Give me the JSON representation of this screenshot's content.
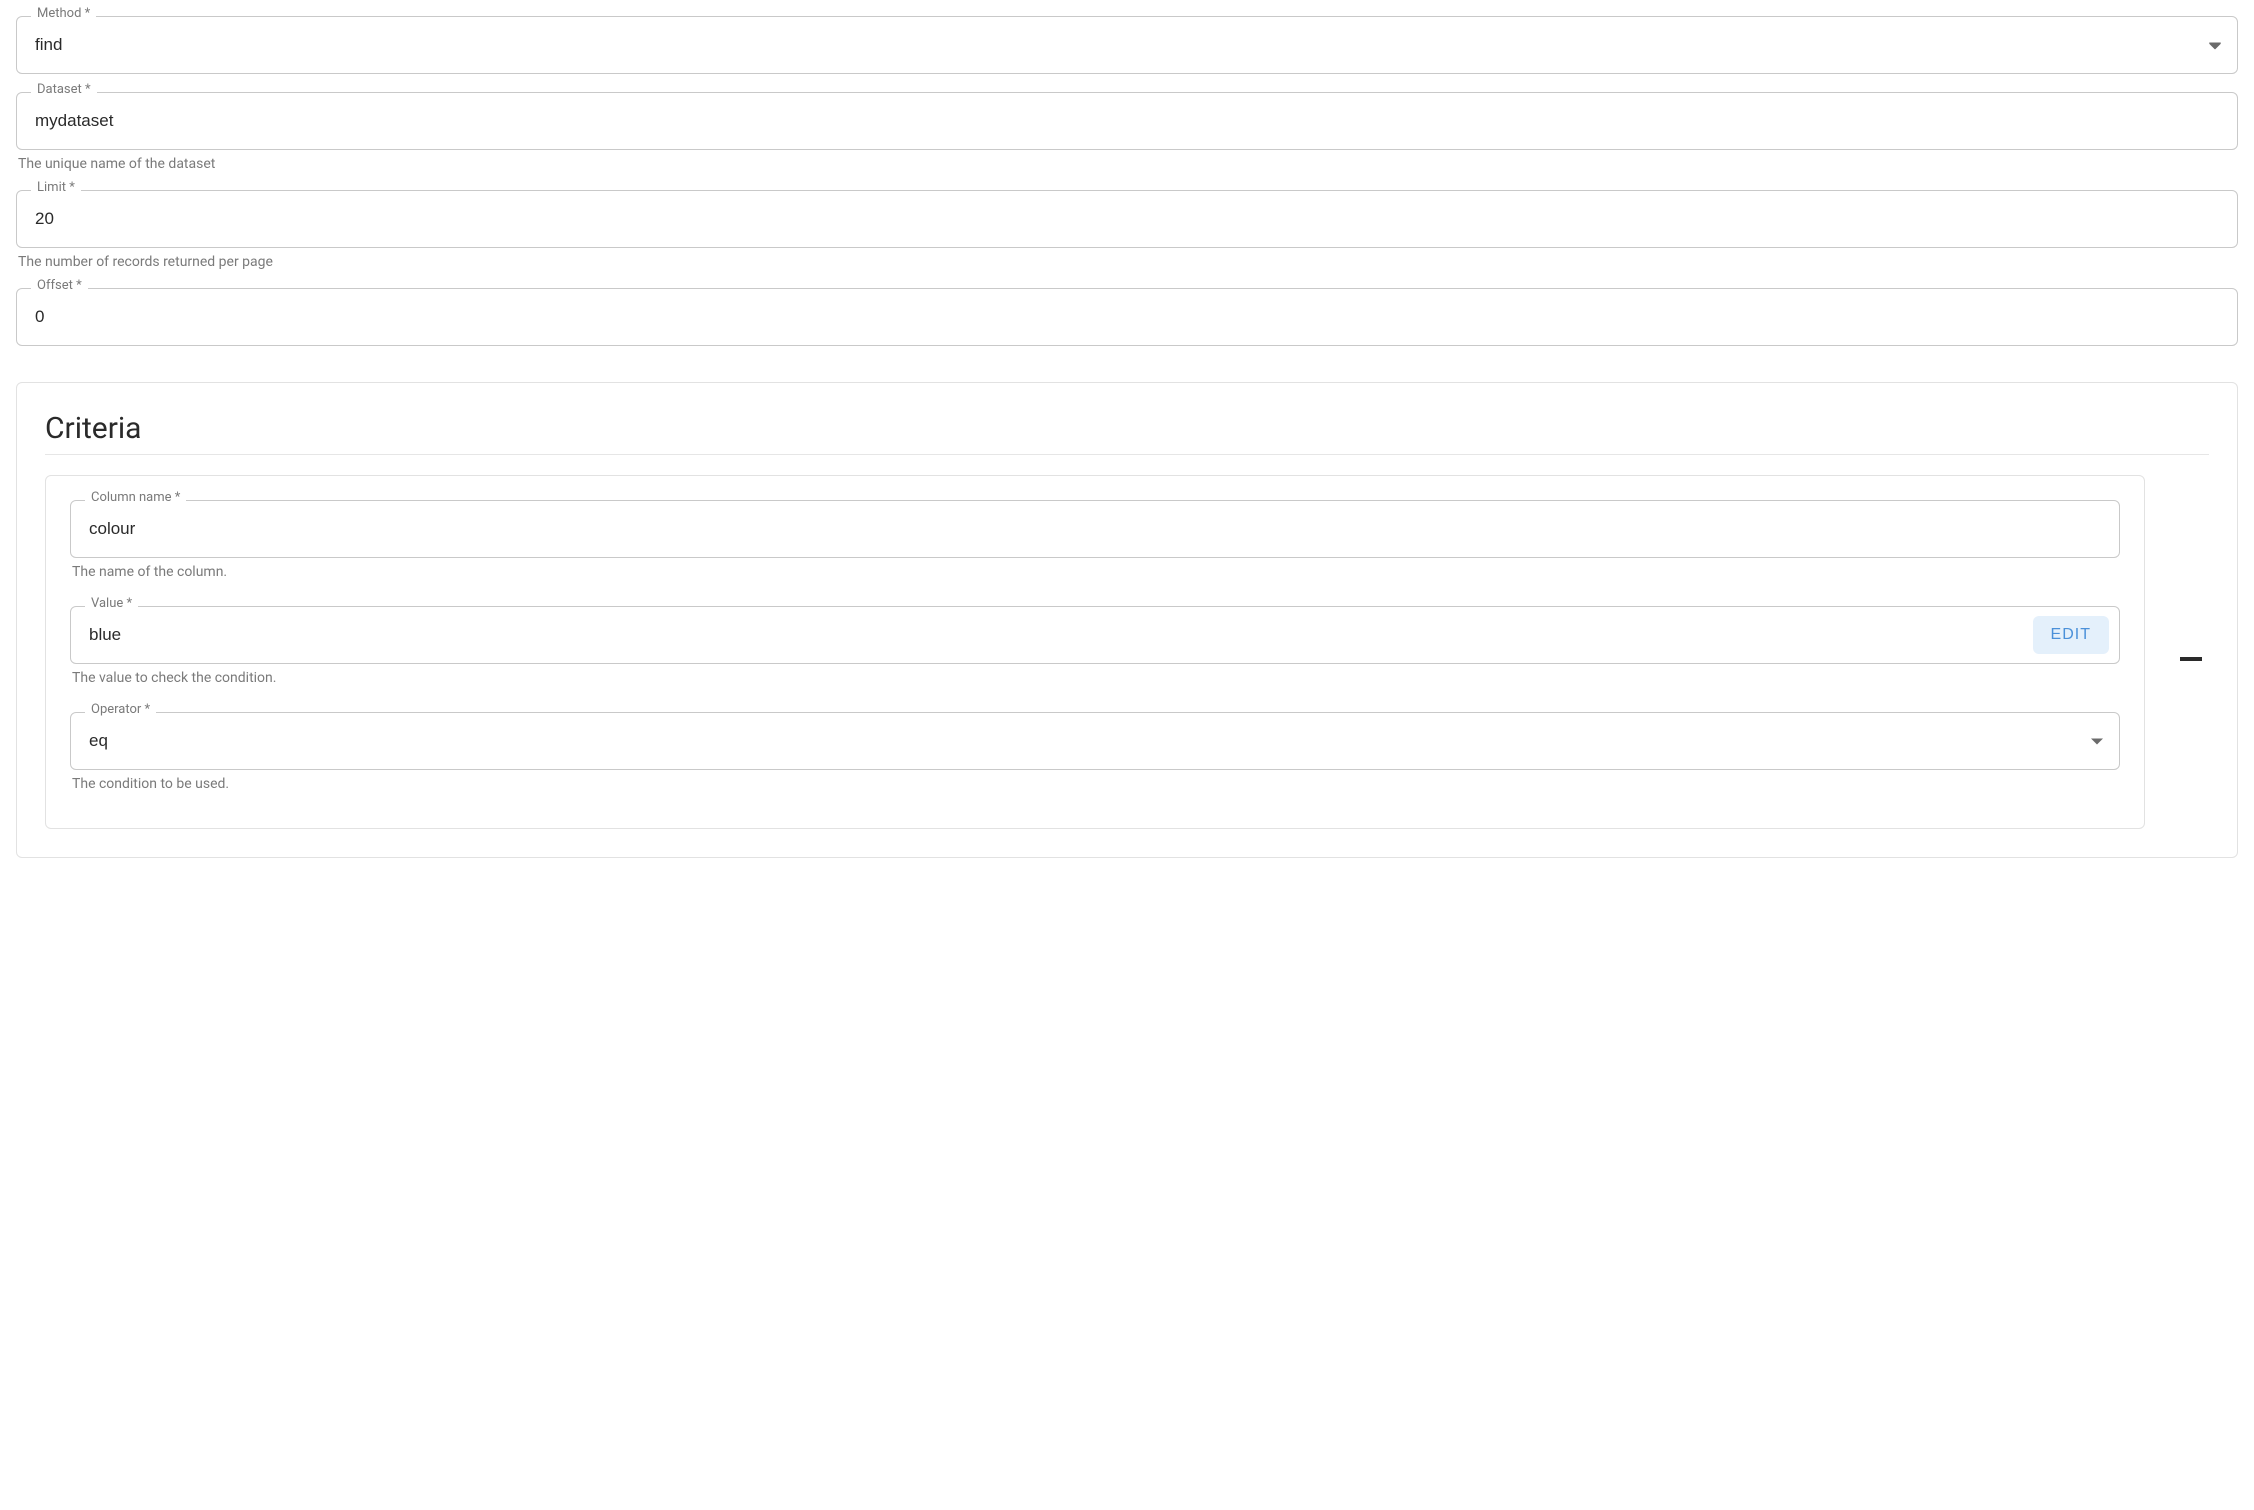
{
  "method": {
    "label": "Method *",
    "value": "find"
  },
  "dataset": {
    "label": "Dataset *",
    "value": "mydataset",
    "helper": "The unique name of the dataset"
  },
  "limit": {
    "label": "Limit *",
    "value": "20",
    "helper": "The number of records returned per page"
  },
  "offset": {
    "label": "Offset *",
    "value": "0"
  },
  "criteria": {
    "title": "Criteria",
    "items": [
      {
        "column": {
          "label": "Column name *",
          "value": "colour",
          "helper": "The name of the column."
        },
        "value": {
          "label": "Value *",
          "value": "blue",
          "helper": "The value to check the condition.",
          "editLabel": "EDIT"
        },
        "operator": {
          "label": "Operator *",
          "value": "eq",
          "helper": "The condition to be used."
        }
      }
    ]
  }
}
